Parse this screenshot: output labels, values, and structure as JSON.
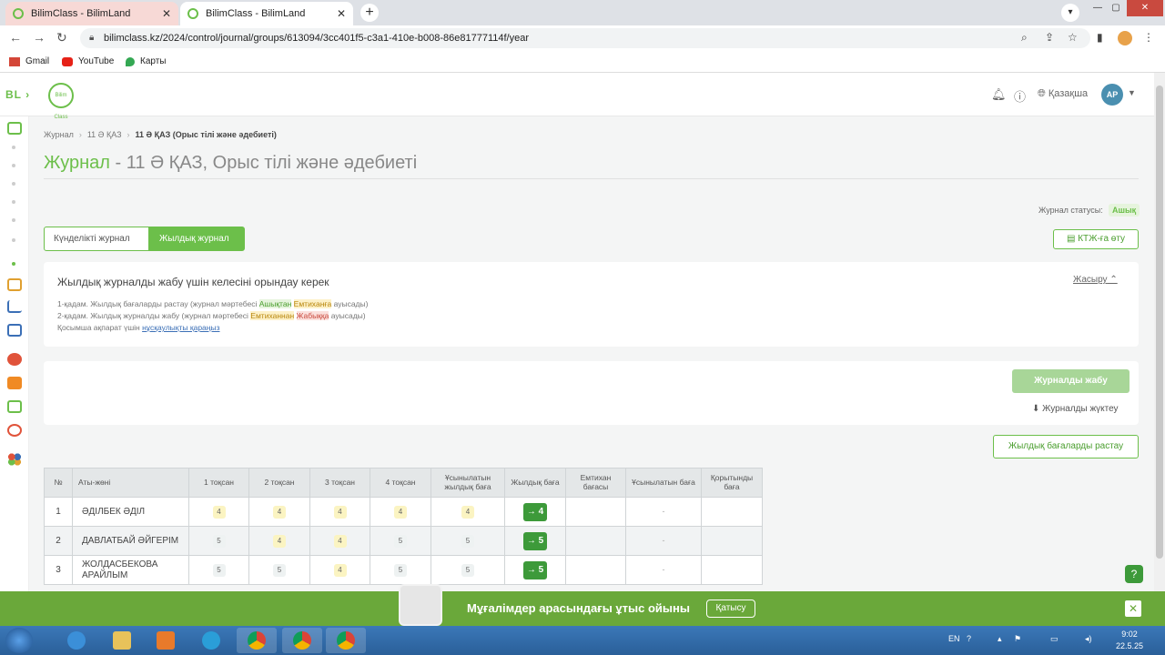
{
  "browser": {
    "tabs": [
      {
        "title": "BilimClass - BilimLand",
        "close": "✕"
      },
      {
        "title": "BilimClass - BilimLand",
        "close": "✕"
      }
    ],
    "new_tab": "+",
    "url": "bilimclass.kz/2024/control/journal/groups/613094/3cc401f5-c3a1-410e-b008-86e81777114f/year",
    "bookmarks": [
      "Gmail",
      "YouTube",
      "Карты"
    ]
  },
  "header": {
    "logo": "BL",
    "brand": "Bilim Class",
    "language": "Қазақша",
    "avatar_initials": "АР"
  },
  "breadcrumb": {
    "items": [
      "Журнал",
      "11 Ә ҚАЗ",
      "11 Ә ҚАЗ (Орыс тілі және әдебиеті)"
    ]
  },
  "title": {
    "prefix": "Журнал",
    "rest": " - 11 Ә ҚАЗ, Орыс тілі және әдебиеті"
  },
  "status": {
    "label": "Журнал статусы:",
    "value": "Ашық"
  },
  "tabs": {
    "daily": "Күнделікті журнал",
    "yearly": "Жылдық журнал"
  },
  "ktzh_button": "КТЖ-ға өту",
  "info": {
    "title": "Жылдық журналды жабу үшін келесіні орындау керек",
    "hide": "Жасыру",
    "step1_a": "1-қадам. Жылдық бағаларды растау (журнал мәртебесі ",
    "step1_b": "Ашықтан",
    "step1_c": " ",
    "step1_d": "Емтиханға",
    "step1_e": " ауысады)",
    "step2_a": "2-қадам. Жылдық журналды жабу (журнал мәртебесі ",
    "step2_b": "Емтиханнан",
    "step2_c": " ",
    "step2_d": "Жабыққа",
    "step2_e": " ауысады)",
    "more_a": "Қосымша ақпарат үшін ",
    "more_link": "нұсқаулықты қараңыз"
  },
  "actions": {
    "close_journal": "Журналды жабу",
    "download": "Журналды жүктеу",
    "approve": "Жылдық бағаларды растау"
  },
  "table": {
    "headers": [
      "№",
      "Аты-жөні",
      "1 тоқсан",
      "2 тоқсан",
      "3 тоқсан",
      "4 тоқсан",
      "Ұсынылатын жылдық баға",
      "Жылдық баға",
      "Емтихан бағасы",
      "Ұсынылатын баға",
      "Қорытынды баға"
    ],
    "rows": [
      {
        "num": "1",
        "name": "ӘДІЛБЕК ӘДІЛ",
        "q1": "4",
        "q2": "4",
        "q3": "4",
        "q4": "4",
        "rec": "4",
        "year": "→ 4",
        "exam": "",
        "rec2": "-",
        "final": ""
      },
      {
        "num": "2",
        "name": "ДАВЛАТБАЙ ӘЙГЕРІМ",
        "q1": "5",
        "q2": "4",
        "q3": "4",
        "q4": "5",
        "rec": "5",
        "year": "→ 5",
        "exam": "",
        "rec2": "-",
        "final": ""
      },
      {
        "num": "3",
        "name": "ЖОЛДАСБЕКОВА АРАЙЛЫМ",
        "q1": "5",
        "q2": "5",
        "q3": "4",
        "q4": "5",
        "rec": "5",
        "year": "→ 5",
        "exam": "",
        "rec2": "-",
        "final": ""
      }
    ]
  },
  "promo": {
    "text": "Мұғалімдер арасындағы ұтыс ойыны",
    "button": "Қатысу",
    "close": "✕"
  },
  "taskbar": {
    "lang": "EN",
    "time": "9:02",
    "date": "22.5.25"
  },
  "colors": {
    "accent": "#6cbf4a",
    "dark_green": "#3d9a3a",
    "promo": "#6aa83a"
  }
}
